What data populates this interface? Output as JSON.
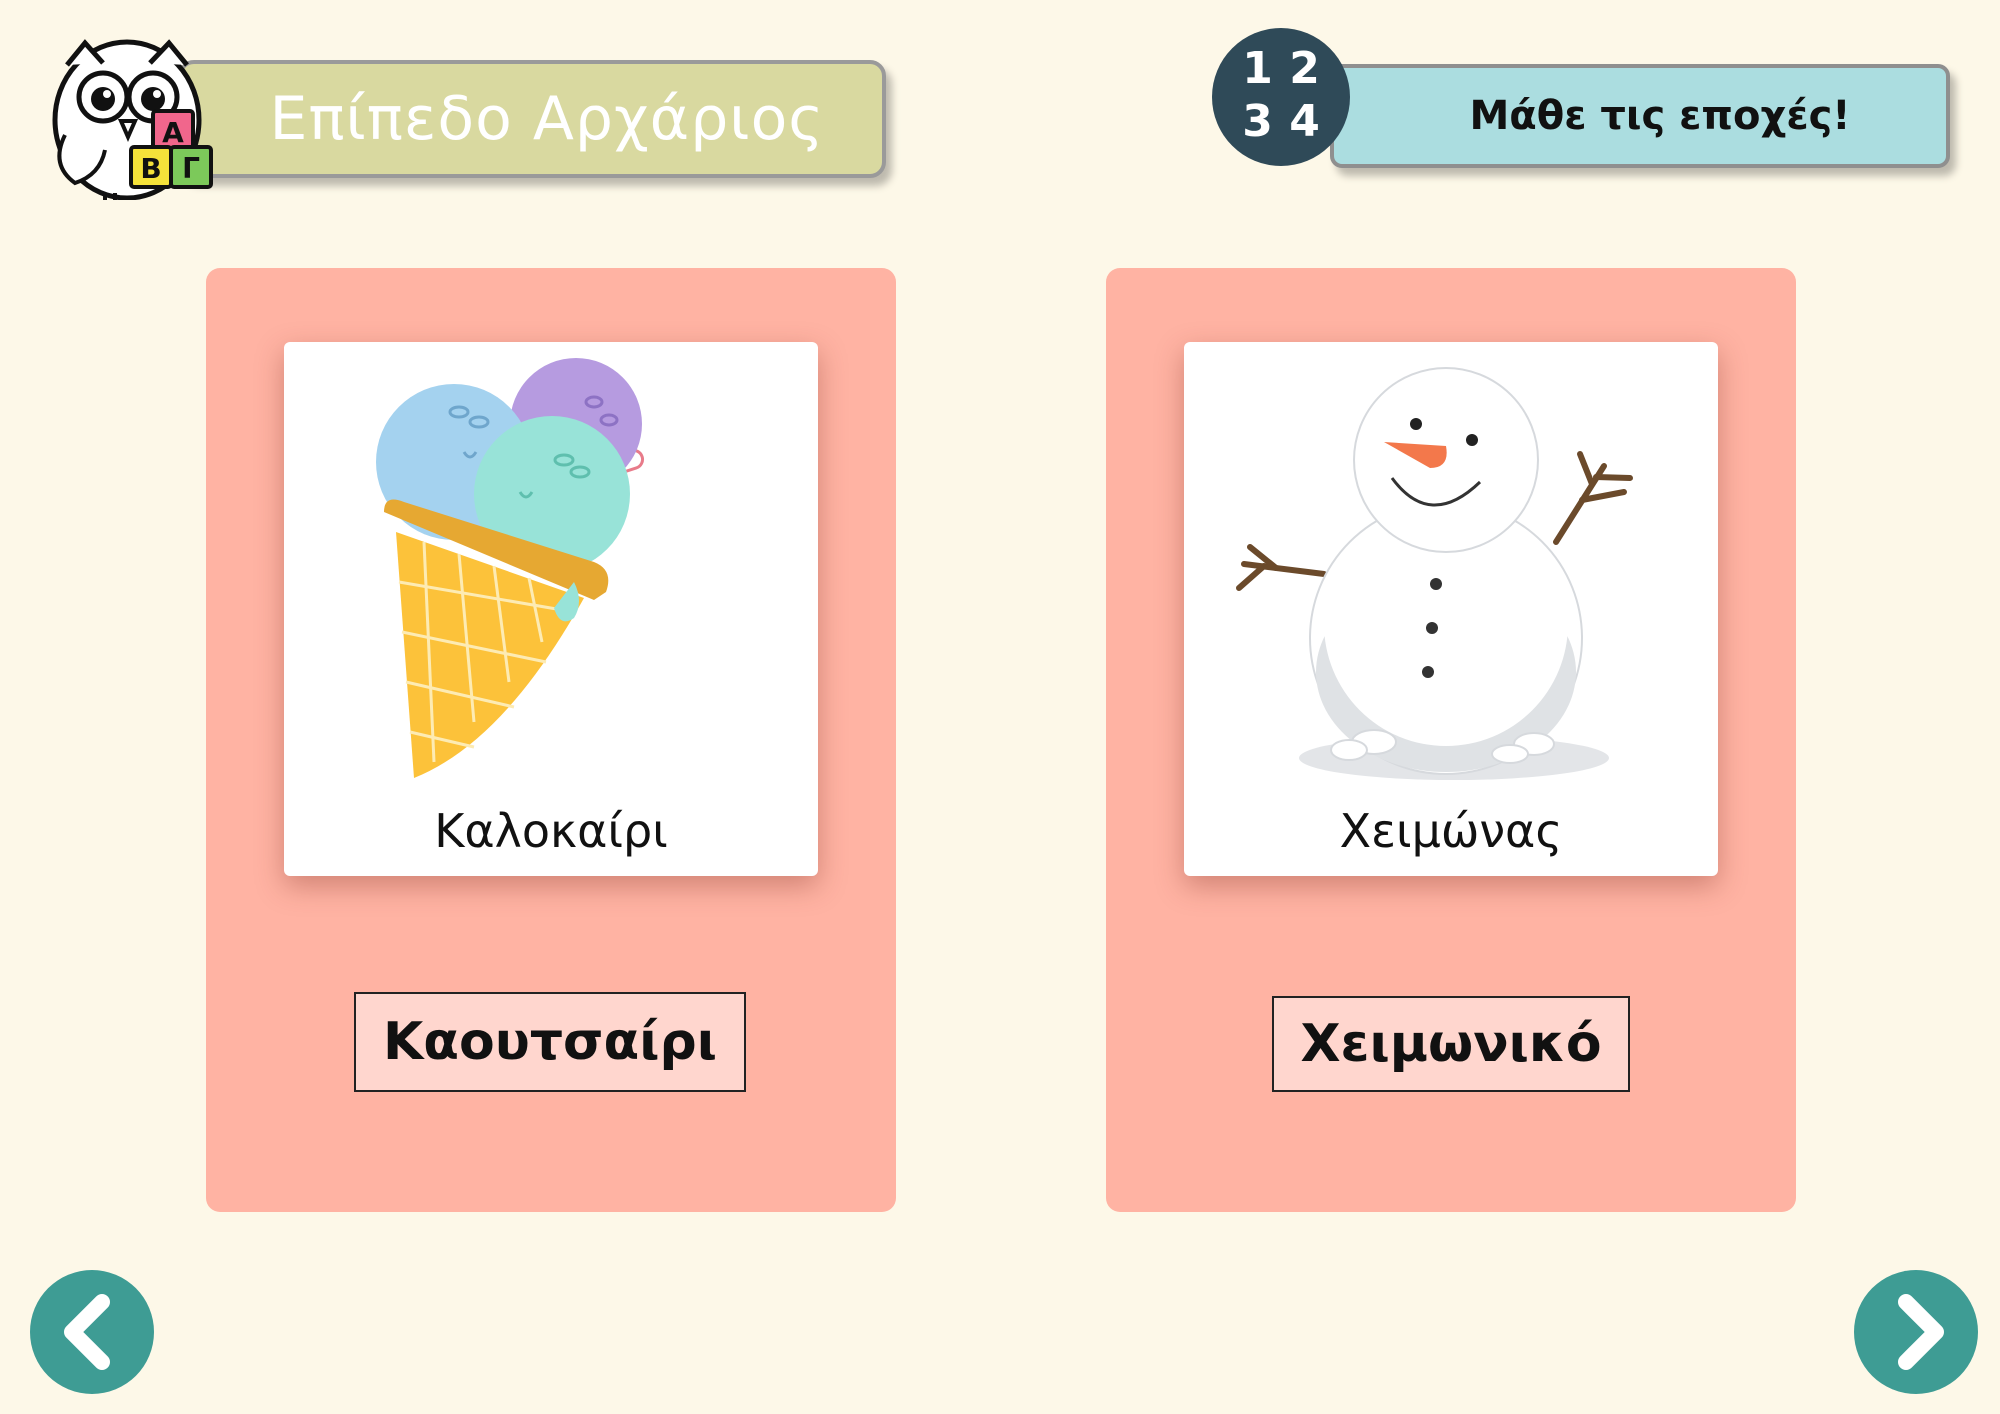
{
  "header": {
    "level_label": "Επίπεδο Αρχάριος",
    "logo_blocks": [
      "A",
      "B",
      "Γ"
    ],
    "numbers_badge": [
      "1",
      "2",
      "3",
      "4"
    ],
    "title": "Μάθε τις εποχές!"
  },
  "cards": [
    {
      "picture_icon": "ice-cream-cone",
      "caption": "Καλοκαίρι",
      "answer": "Καουτσαίρι"
    },
    {
      "picture_icon": "snowman",
      "caption": "Χειμώνας",
      "answer": "Χειμωνικό"
    }
  ],
  "navigation": {
    "prev_icon": "chevron-left-icon",
    "next_icon": "chevron-right-icon"
  },
  "colors": {
    "background": "#fdf8e8",
    "card": "#ffb3a3",
    "answer_box": "#ffd6ce",
    "level_banner": "#d9d9a0",
    "title_banner": "#abdde0",
    "nav_button": "#3e9c94",
    "numbers_badge": "#2f4a58"
  }
}
